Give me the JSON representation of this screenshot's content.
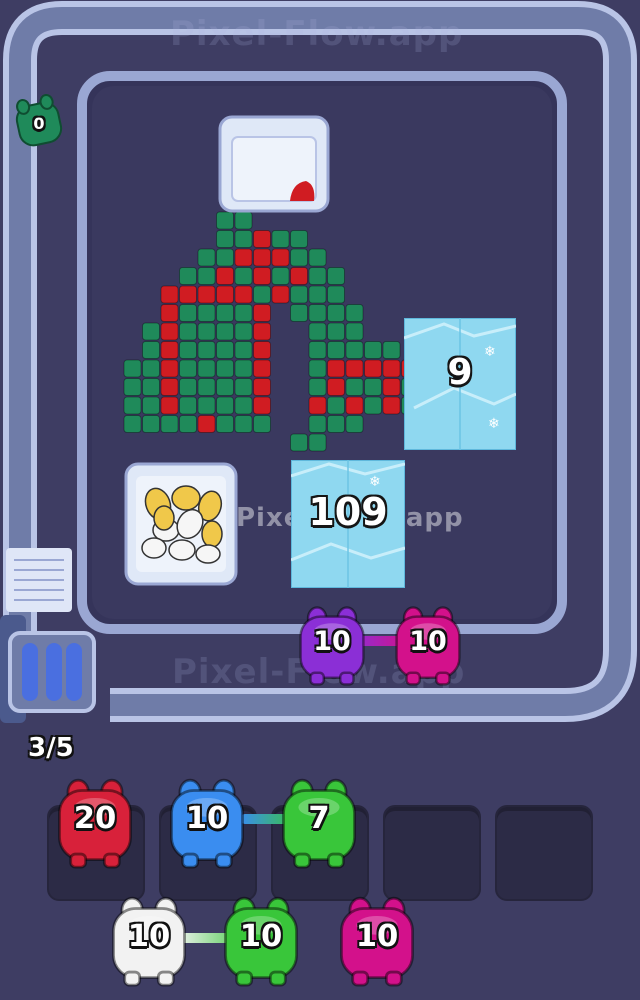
{
  "watermark": "Pixel-Flow.app",
  "queue_counter": "3/5",
  "conveyor_pig": {
    "value": "0",
    "color": "#1f8a5a"
  },
  "blocks": {
    "ice_small": {
      "value": "9"
    },
    "ice_large": {
      "value": "109"
    }
  },
  "pixel_colors": {
    "green": "#1f8a5a",
    "red": "#d01c22",
    "ice": "#8fd8f0",
    "track": "#b9c4e6"
  },
  "conveyor_pigs": [
    {
      "value": "10",
      "color": "#8b2fd6"
    },
    {
      "value": "10",
      "color": "#d3118b"
    }
  ],
  "slots": [
    {
      "value": "20",
      "color": "#d8213a"
    },
    {
      "value": "10",
      "color": "#3a8df0"
    },
    {
      "value": "7",
      "color": "#39c63a"
    },
    {
      "value": "",
      "color": ""
    },
    {
      "value": "",
      "color": ""
    }
  ],
  "reserve_pigs": [
    {
      "value": "10",
      "color": "#f2f2f2"
    },
    {
      "value": "10",
      "color": "#39c63a"
    },
    {
      "value": "10",
      "color": "#d3118b"
    }
  ]
}
